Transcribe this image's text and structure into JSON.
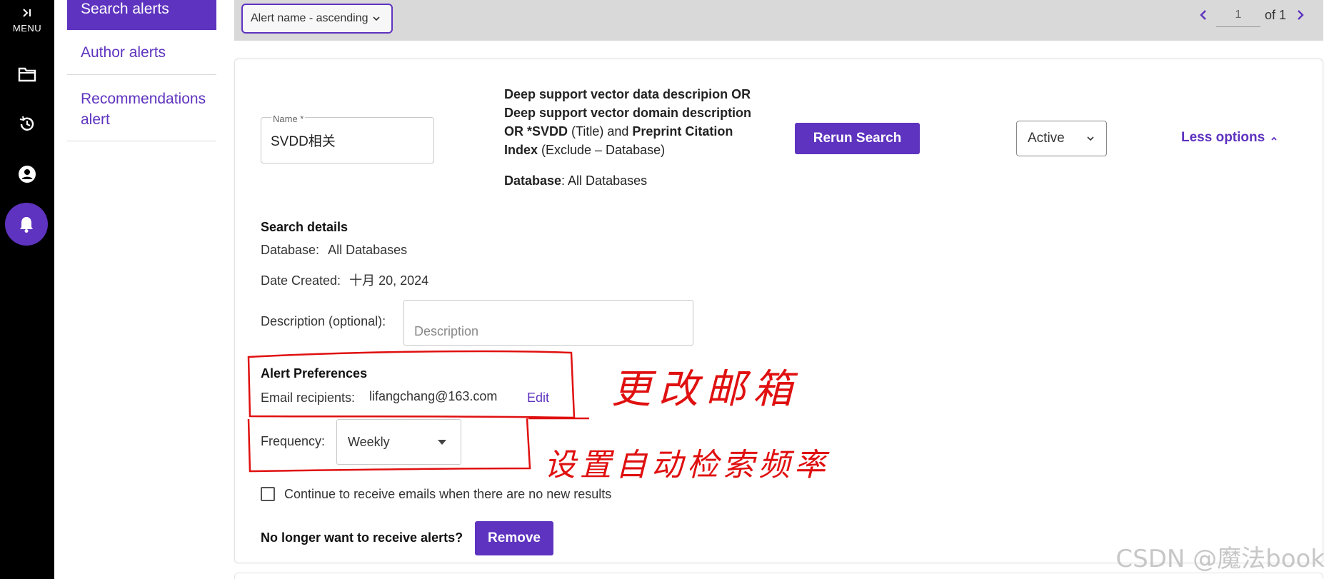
{
  "rail": {
    "menu_label": "MENU",
    "menu_chevron": ">I",
    "icons": [
      "menu-expand-icon",
      "folder-icon",
      "history-icon",
      "account-icon",
      "bell-icon"
    ]
  },
  "subnav": {
    "items": [
      {
        "label": "Search alerts",
        "active": true
      },
      {
        "label": "Author alerts",
        "active": false
      },
      {
        "label": "Recommendations alert",
        "active": false
      }
    ]
  },
  "toolbar": {
    "sort_label": "Alert name - ascending",
    "page_value": "1",
    "page_of": "of 1"
  },
  "alert": {
    "name_label": "Name *",
    "name_value": "SVDD相关",
    "query_part1": "Deep support vector data descripion OR Deep support vector domain description OR *SVDD",
    "query_part2": " (Title) and ",
    "query_part3": "Preprint Citation Index",
    "query_part4": " (Exclude – Database)",
    "database_label": "Database",
    "database_value": ": All Databases",
    "rerun_label": "Rerun Search",
    "status_value": "Active",
    "less_options_label": "Less options"
  },
  "search_details": {
    "title": "Search details",
    "database_label": "Database:",
    "database_value": "All Databases",
    "date_label": "Date Created:",
    "date_value": "十月 20, 2024",
    "description_label": "Description (optional):",
    "description_placeholder": "Description"
  },
  "preferences": {
    "title": "Alert Preferences",
    "email_label": "Email recipients:",
    "email_value": "lifangchang@163.com",
    "edit_label": "Edit",
    "frequency_label": "Frequency:",
    "frequency_value": "Weekly",
    "continue_label": "Continue to receive emails when there are no new results",
    "continue_checked": false,
    "no_longer_label": "No longer want to receive alerts?",
    "remove_label": "Remove"
  },
  "annotations": {
    "note1": "更改邮箱",
    "note2": "设置自动检索频率",
    "color": "#e01010"
  },
  "watermark": "CSDN @魔法book",
  "colors": {
    "accent": "#5e33bf",
    "rail": "#000000",
    "toolbar": "#d9d9d9"
  }
}
